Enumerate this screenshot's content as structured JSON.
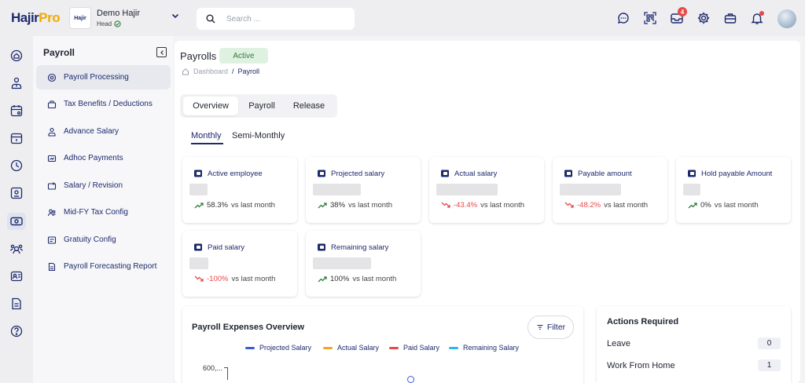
{
  "brand": {
    "name_part1": "Hajir",
    "name_part2": "Pro"
  },
  "org": {
    "logo_text": "Hajir",
    "name": "Demo Hajir",
    "role": "Head"
  },
  "search": {
    "placeholder": "Search ..."
  },
  "notifications": {
    "inbox_count": "4"
  },
  "icons": {
    "topbar": [
      "chat-icon",
      "qr-code-icon",
      "inbox-icon",
      "settings-icon",
      "briefcase-icon",
      "bell-icon"
    ],
    "rail": [
      "home-icon",
      "user-tie-icon",
      "calendar-icon",
      "calendar-day-icon",
      "clock-icon",
      "payslip-icon",
      "payroll-icon",
      "team-icon",
      "id-card-icon",
      "document-icon",
      "help-icon"
    ]
  },
  "sidebar": {
    "title": "Payroll",
    "items": [
      {
        "label": "Payroll Processing",
        "icon": "payroll-process-icon",
        "active": true
      },
      {
        "label": "Tax Benefits / Deductions",
        "icon": "tax-icon",
        "active": false
      },
      {
        "label": "Advance Salary",
        "icon": "advance-salary-icon",
        "active": false
      },
      {
        "label": "Adhoc Payments",
        "icon": "adhoc-payment-icon",
        "active": false
      },
      {
        "label": "Salary / Revision",
        "icon": "salary-revision-icon",
        "active": false
      },
      {
        "label": "Mid-FY Tax Config",
        "icon": "tax-config-icon",
        "active": false
      },
      {
        "label": "Gratuity Config",
        "icon": "gratuity-icon",
        "active": false
      },
      {
        "label": "Payroll Forecasting Report",
        "icon": "report-icon",
        "active": false
      }
    ]
  },
  "header": {
    "title": "Payrolls",
    "status": "Active"
  },
  "breadcrumb": {
    "home": "Dashboard",
    "separator": "/",
    "current": "Payroll"
  },
  "tabs": [
    {
      "label": "Overview",
      "active": true
    },
    {
      "label": "Payroll",
      "active": false
    },
    {
      "label": "Release",
      "active": false
    }
  ],
  "subtabs": [
    {
      "label": "Monthly",
      "active": true
    },
    {
      "label": "Semi-Monthly",
      "active": false
    }
  ],
  "cards": [
    {
      "title": "Active employee",
      "trend": "up",
      "change": "58.3%",
      "suffix": "vs last month"
    },
    {
      "title": "Projected salary",
      "trend": "up",
      "change": "38%",
      "suffix": "vs last month"
    },
    {
      "title": "Actual salary",
      "trend": "down",
      "change": "-43.4%",
      "suffix": "vs last month"
    },
    {
      "title": "Payable amount",
      "trend": "down",
      "change": "-48.2%",
      "suffix": "vs last month"
    },
    {
      "title": "Hold payable Amount",
      "trend": "up",
      "change": "0%",
      "suffix": "vs last month"
    },
    {
      "title": "Paid salary",
      "trend": "down",
      "change": "-100%",
      "suffix": "vs last month"
    },
    {
      "title": "Remaining salary",
      "trend": "up",
      "change": "100%",
      "suffix": "vs last month"
    }
  ],
  "colors": {
    "brand": "#1d2a6d",
    "accent": "#f2a900",
    "up": "#2f7d3b",
    "down": "#e84848",
    "projected": "#3b5bdb",
    "actual": "#f5a623",
    "paid": "#e84848",
    "remaining": "#29b6f6"
  },
  "chart": {
    "title": "Payroll Expenses Overview",
    "filter_label": "Filter",
    "y_label_top": "600,..."
  },
  "chart_data": {
    "type": "line",
    "title": "Payroll Expenses Overview",
    "series": [
      {
        "name": "Projected Salary",
        "values": []
      },
      {
        "name": "Actual Salary",
        "values": []
      },
      {
        "name": "Paid Salary",
        "values": []
      },
      {
        "name": "Remaining Salary",
        "values": []
      }
    ],
    "y_tick_labels": [
      "600,..."
    ],
    "legend": "top-center"
  },
  "actions": {
    "title": "Actions Required",
    "items": [
      {
        "label": "Leave",
        "count": "0"
      },
      {
        "label": "Work From Home",
        "count": "1"
      }
    ]
  }
}
